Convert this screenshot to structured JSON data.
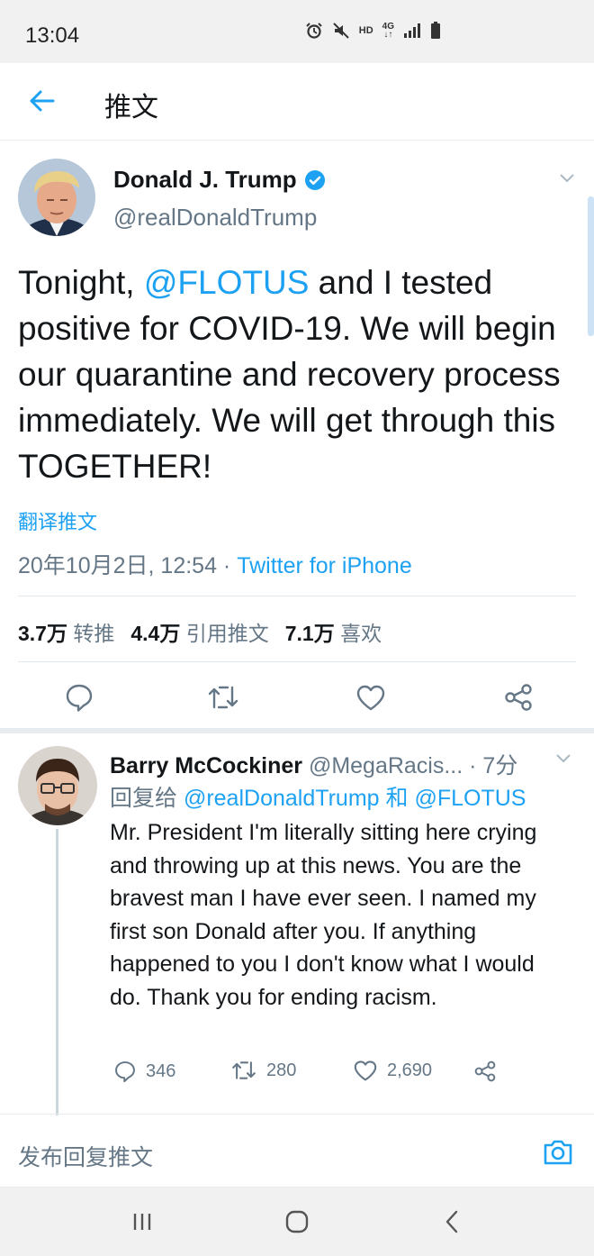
{
  "status_bar": {
    "time": "13:04",
    "hd": "HD",
    "network": "4G"
  },
  "header": {
    "title": "推文"
  },
  "tweet": {
    "author_name": "Donald J. Trump",
    "author_handle": "@realDonaldTrump",
    "text_before": "Tonight, ",
    "mention": "@FLOTUS",
    "text_after": " and I tested positive for COVID-19. We will begin our quarantine and recovery process immediately. We will get through this TOGETHER!",
    "translate_link": "翻译推文",
    "timestamp": "20年10月2日, 12:54 · ",
    "source": "Twitter for iPhone",
    "stats": {
      "retweets_count": "3.7万",
      "retweets_label": "转推",
      "quotes_count": "4.4万",
      "quotes_label": "引用推文",
      "likes_count": "7.1万",
      "likes_label": "喜欢"
    }
  },
  "reply": {
    "author_name": "Barry McCockiner",
    "author_handle": "@MegaRacis...",
    "time": " · 7分",
    "reply_to_prefix": "回复给 ",
    "reply_to_user1": "@realDonaldTrump",
    "reply_to_and": " 和 ",
    "reply_to_user2": "@FLOTUS",
    "text": "Mr. President I'm literally sitting here crying and throwing up at this news. You are the bravest man I have ever seen. I named my first son Donald after you. If anything happened to you I don't know what I would do. Thank you for ending racism.",
    "replies": "346",
    "retweets": "280",
    "likes": "2,690"
  },
  "compose": {
    "placeholder": "发布回复推文"
  },
  "colors": {
    "accent": "#1da1f2",
    "text": "#14171a",
    "secondary": "#657786"
  }
}
